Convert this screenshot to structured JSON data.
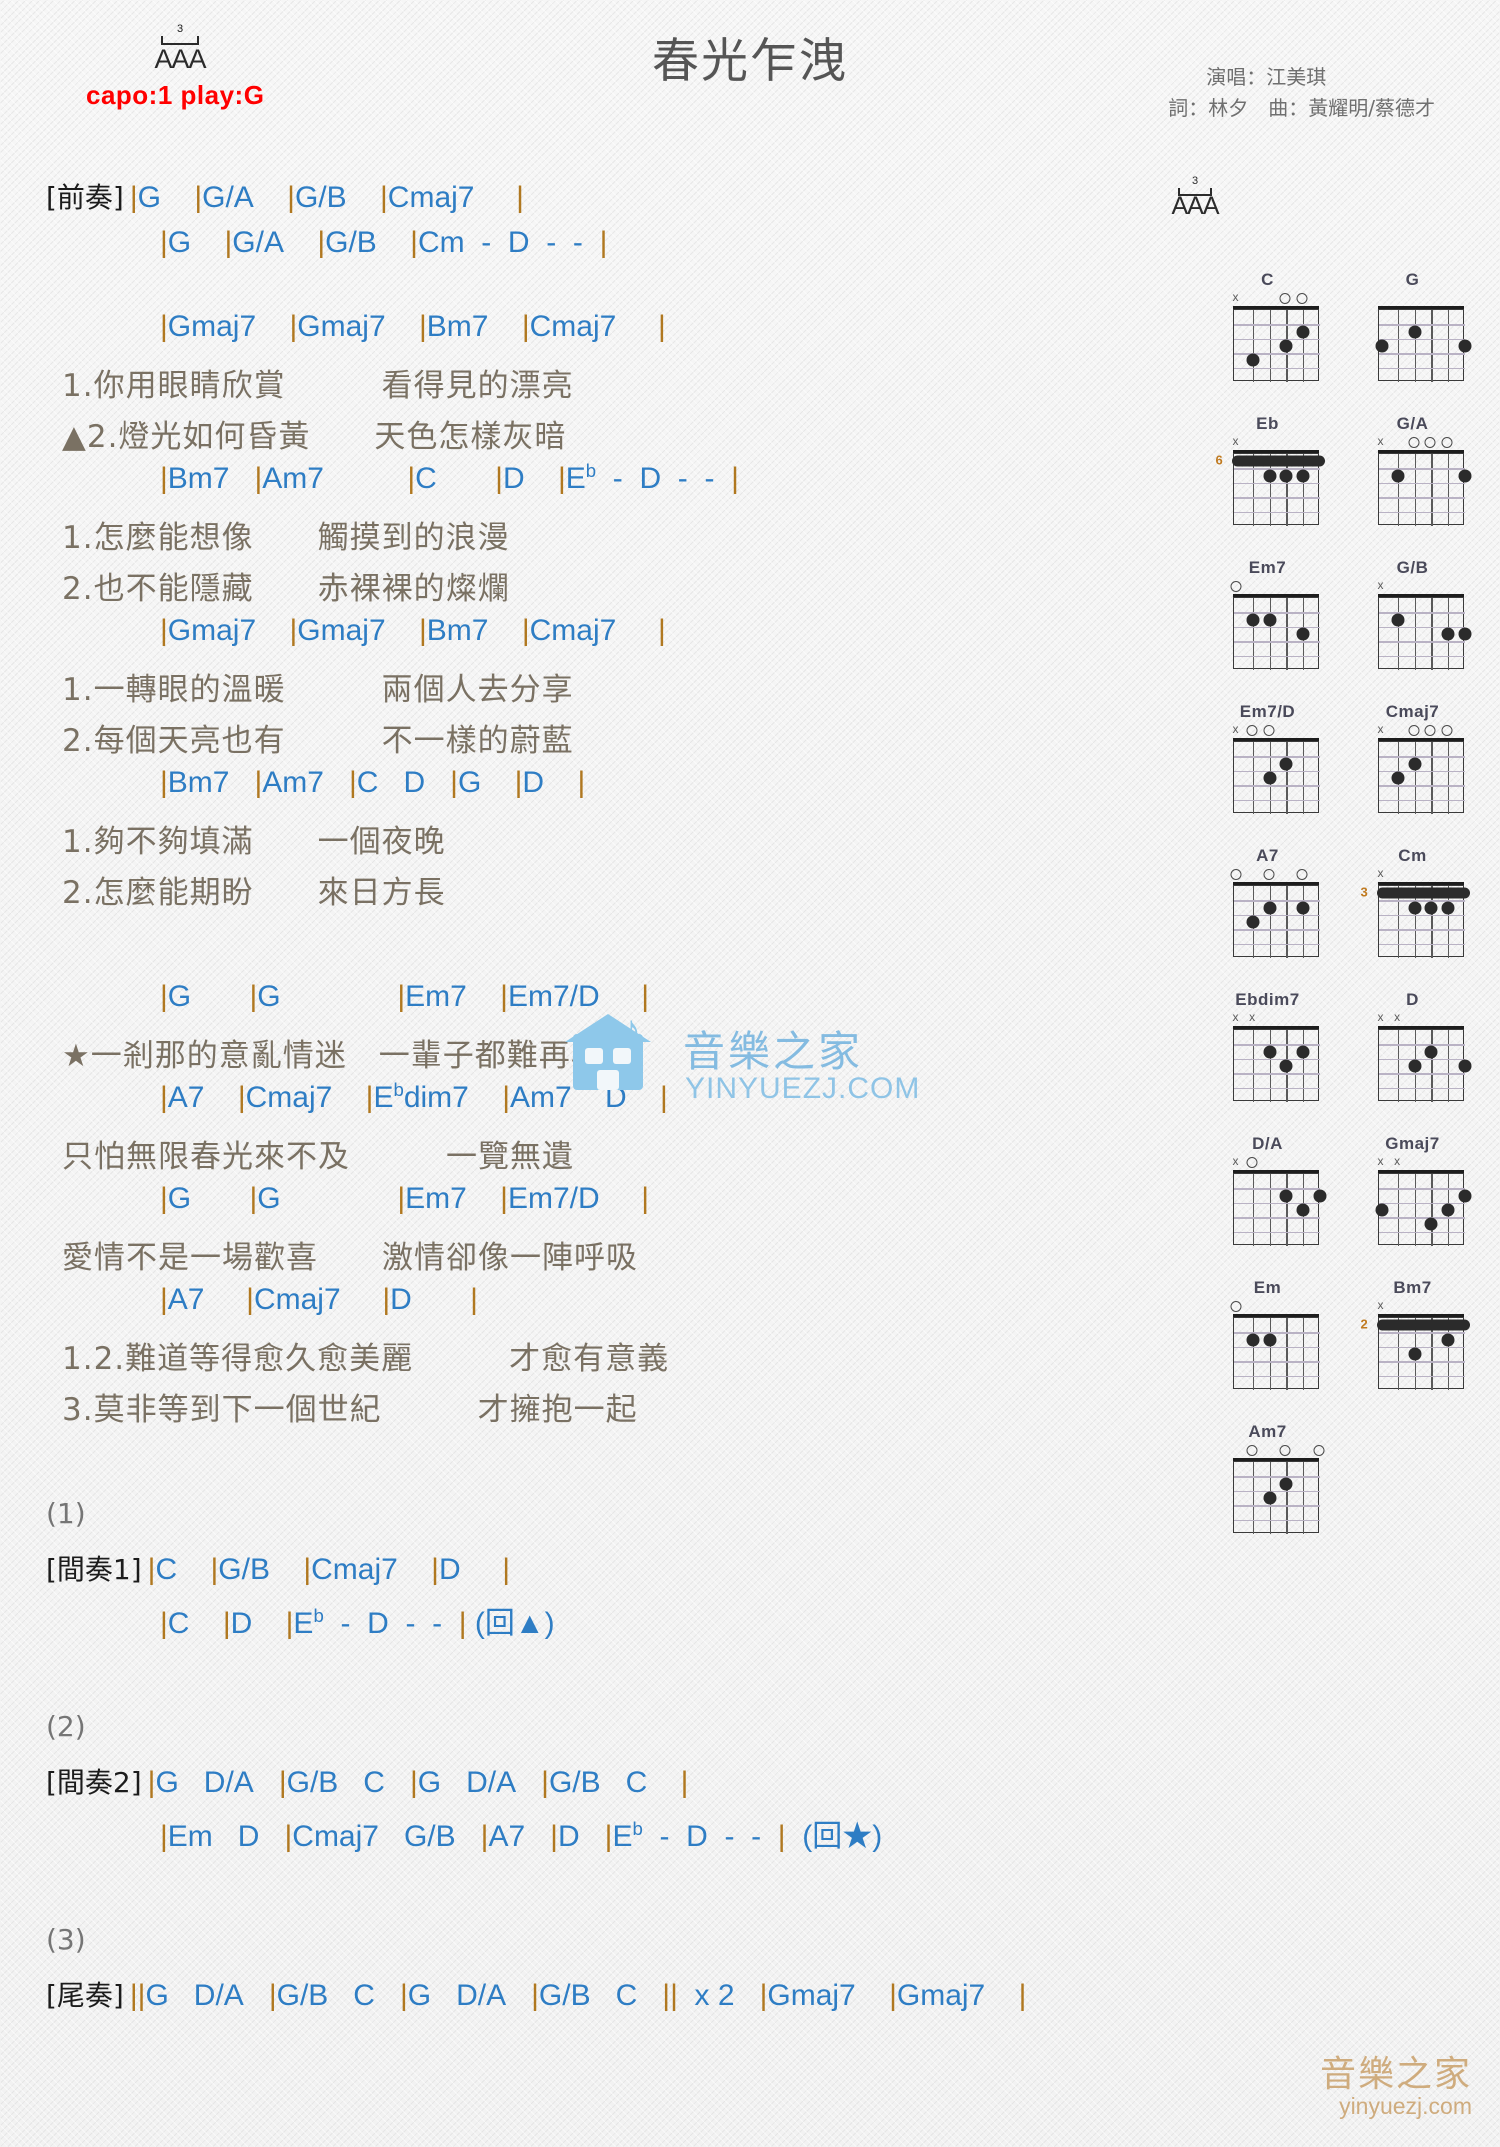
{
  "header": {
    "title": "春光乍洩",
    "capo": "capo:1 play:G",
    "triplet_number": "3",
    "aaa": "AAA",
    "singer_line": "演唱：江美琪",
    "credit_line": "詞：林夕　曲：黃耀明/蔡德才"
  },
  "colors": {
    "chord": "#2e7dc4",
    "barline": "#b07820",
    "lyric": "#7a7163",
    "capo": "#ff0000",
    "title": "#555555",
    "watermark_blue": "#8ec8ea",
    "watermark_gold": "#c9a06a"
  },
  "sections": [
    {
      "type": "chord",
      "tag": "[前奏]",
      "chords": "|G    |G/A    |G/B    |Cmaj7     |"
    },
    {
      "type": "chord",
      "tag": "",
      "chords": "|G    |G/A    |G/B    |Cm  -  D  -  -  |"
    },
    {
      "type": "spacer"
    },
    {
      "type": "chord",
      "tag": "",
      "chords": "|Gmaj7    |Gmaj7    |Bm7    |Cmaj7     |"
    },
    {
      "type": "lyric",
      "text": "1.你用眼睛欣賞　　　看得見的漂亮"
    },
    {
      "type": "lyric",
      "text": "▲2.燈光如何昏黃　　天色怎樣灰暗"
    },
    {
      "type": "chord",
      "tag": "",
      "chords": "|Bm7   |Am7          |C       |D    |E♭  -  D  -  -  |"
    },
    {
      "type": "lyric",
      "text": "1.怎麼能想像　　觸摸到的浪漫"
    },
    {
      "type": "lyric",
      "text": "2.也不能隱藏　　赤裸裸的燦爛"
    },
    {
      "type": "chord",
      "tag": "",
      "chords": "|Gmaj7    |Gmaj7    |Bm7    |Cmaj7     |"
    },
    {
      "type": "lyric",
      "text": "1.一轉眼的溫暖　　　兩個人去分享"
    },
    {
      "type": "lyric",
      "text": "2.每個天亮也有　　　不一樣的蔚藍"
    },
    {
      "type": "chord",
      "tag": "",
      "chords": "|Bm7   |Am7   |C   D   |G    |D    |"
    },
    {
      "type": "lyric",
      "text": "1.夠不夠填滿　　一個夜晚"
    },
    {
      "type": "lyric",
      "text": "2.怎麼能期盼　　來日方長"
    },
    {
      "type": "spacer-lg"
    },
    {
      "type": "chord",
      "tag": "",
      "chords": "|G       |G              |Em7    |Em7/D     |"
    },
    {
      "type": "lyric",
      "text": "★一剎那的意亂情迷　一輩子都難再尋覓"
    },
    {
      "type": "chord",
      "tag": "",
      "chords": "|A7    |Cmaj7    |E♭dim7    |Am7    D    |"
    },
    {
      "type": "lyric",
      "text": "只怕無限春光來不及　　　一覽無遺"
    },
    {
      "type": "chord",
      "tag": "",
      "chords": "|G       |G              |Em7    |Em7/D     |"
    },
    {
      "type": "lyric",
      "text": "愛情不是一場歡喜　　激情卻像一陣呼吸"
    },
    {
      "type": "chord",
      "tag": "",
      "chords": "|A7     |Cmaj7     |D       |"
    },
    {
      "type": "lyric",
      "text": "1.2.難道等得愈久愈美麗　　　才愈有意義"
    },
    {
      "type": "lyric",
      "text": "3.莫非等到下一個世紀　　　才擁抱一起"
    },
    {
      "type": "spacer-lg"
    },
    {
      "type": "paren",
      "text": "(1)"
    },
    {
      "type": "chord",
      "tag": "[間奏1]",
      "chords": "|C    |G/B    |Cmaj7    |D     |"
    },
    {
      "type": "chord",
      "tag": "",
      "chords": "|C    |D    |E♭  -  D  -  -  | (回▲)"
    },
    {
      "type": "spacer-lg"
    },
    {
      "type": "paren",
      "text": "(2)"
    },
    {
      "type": "chord",
      "tag": "[間奏2]",
      "chords": "|G   D/A   |G/B   C   |G   D/A   |G/B   C    |"
    },
    {
      "type": "chord",
      "tag": "",
      "chords": "|Em   D   |Cmaj7   G/B   |A7   |D   |E♭  -  D  -  -  |  (回★)"
    },
    {
      "type": "spacer-lg"
    },
    {
      "type": "paren",
      "text": "(3)"
    },
    {
      "type": "chord",
      "tag": "[尾奏]",
      "chords": "||G   D/A   |G/B   C   |G   D/A   |G/B   C   ||  x 2   |Gmaj7    |Gmaj7    |"
    }
  ],
  "chord_diagrams": [
    {
      "name": "C",
      "base_fret": "",
      "markers": [
        "x",
        "",
        "",
        "o",
        "o",
        ""
      ],
      "dots": [
        [
          2,
          5
        ],
        [
          3,
          4
        ],
        [
          4,
          2
        ]
      ],
      "barre": null
    },
    {
      "name": "G",
      "base_fret": "",
      "markers": [
        "",
        "",
        "",
        "",
        "",
        ""
      ],
      "dots": [
        [
          2,
          3
        ],
        [
          3,
          1
        ],
        [
          3,
          6
        ]
      ],
      "barre": null
    },
    {
      "name": "Eb",
      "base_fret": "6",
      "markers": [
        "x",
        "",
        "",
        "",
        "",
        ""
      ],
      "dots": [
        [
          2,
          3
        ],
        [
          2,
          4
        ],
        [
          2,
          5
        ]
      ],
      "barre": {
        "fret": 1,
        "from": 1,
        "to": 6
      }
    },
    {
      "name": "G/A",
      "base_fret": "",
      "markers": [
        "x",
        "",
        "o",
        "o",
        "o",
        ""
      ],
      "dots": [
        [
          2,
          2
        ],
        [
          2,
          6
        ]
      ],
      "barre": null
    },
    {
      "name": "Em7",
      "base_fret": "",
      "markers": [
        "o",
        "",
        "",
        "",
        "",
        ""
      ],
      "dots": [
        [
          2,
          2
        ],
        [
          2,
          3
        ],
        [
          3,
          5
        ]
      ],
      "barre": null
    },
    {
      "name": "G/B",
      "base_fret": "",
      "markers": [
        "x",
        "",
        "",
        "",
        "",
        ""
      ],
      "dots": [
        [
          2,
          2
        ],
        [
          3,
          5
        ],
        [
          3,
          6
        ]
      ],
      "barre": null
    },
    {
      "name": "Em7/D",
      "base_fret": "",
      "markers": [
        "x",
        "o",
        "o",
        "",
        "",
        ""
      ],
      "dots": [
        [
          2,
          4
        ],
        [
          3,
          3
        ]
      ],
      "barre": null
    },
    {
      "name": "Cmaj7",
      "base_fret": "",
      "markers": [
        "x",
        "",
        "o",
        "o",
        "o",
        ""
      ],
      "dots": [
        [
          2,
          3
        ],
        [
          3,
          2
        ]
      ],
      "barre": null
    },
    {
      "name": "A7",
      "base_fret": "",
      "markers": [
        "o",
        "",
        "o",
        "",
        "o",
        ""
      ],
      "dots": [
        [
          2,
          3
        ],
        [
          2,
          5
        ],
        [
          3,
          2
        ]
      ],
      "barre": null
    },
    {
      "name": "Cm",
      "base_fret": "3",
      "markers": [
        "x",
        "",
        "",
        "",
        "",
        ""
      ],
      "dots": [
        [
          2,
          3
        ],
        [
          2,
          4
        ],
        [
          2,
          5
        ]
      ],
      "barre": {
        "fret": 1,
        "from": 1,
        "to": 6
      }
    },
    {
      "name": "Ebdim7",
      "base_fret": "",
      "markers": [
        "x",
        "x",
        "",
        "",
        "",
        ""
      ],
      "dots": [
        [
          2,
          3
        ],
        [
          2,
          5
        ],
        [
          3,
          4
        ]
      ],
      "barre": null
    },
    {
      "name": "D",
      "base_fret": "",
      "markers": [
        "x",
        "x",
        "",
        "",
        "",
        ""
      ],
      "dots": [
        [
          2,
          4
        ],
        [
          3,
          6
        ],
        [
          3,
          3
        ]
      ],
      "barre": null
    },
    {
      "name": "D/A",
      "base_fret": "",
      "markers": [
        "x",
        "o",
        "",
        "",
        "",
        ""
      ],
      "dots": [
        [
          2,
          4
        ],
        [
          2,
          6
        ],
        [
          3,
          5
        ]
      ],
      "barre": null
    },
    {
      "name": "Gmaj7",
      "base_fret": "",
      "markers": [
        "x",
        "x",
        "",
        "",
        "",
        ""
      ],
      "dots": [
        [
          3,
          1
        ],
        [
          2,
          6
        ],
        [
          3,
          5
        ],
        [
          4,
          4
        ]
      ],
      "barre": null
    },
    {
      "name": "Em",
      "base_fret": "",
      "markers": [
        "o",
        "",
        "",
        "",
        "",
        ""
      ],
      "dots": [
        [
          2,
          2
        ],
        [
          2,
          3
        ]
      ],
      "barre": null
    },
    {
      "name": "Bm7",
      "base_fret": "2",
      "markers": [
        "x",
        "",
        "",
        "",
        "",
        ""
      ],
      "dots": [
        [
          2,
          5
        ],
        [
          3,
          3
        ]
      ],
      "barre": {
        "fret": 1,
        "from": 1,
        "to": 6
      }
    },
    {
      "name": "Am7",
      "base_fret": "",
      "markers": [
        "",
        "o",
        "",
        "o",
        "",
        "o"
      ],
      "dots": [
        [
          2,
          4
        ],
        [
          3,
          3
        ]
      ],
      "barre": null
    }
  ],
  "watermark": {
    "center_text": "音樂之家",
    "center_sub": "YINYUEZJ.COM",
    "corner_text": "音樂之家",
    "corner_sub": "yinyuezj.com"
  }
}
